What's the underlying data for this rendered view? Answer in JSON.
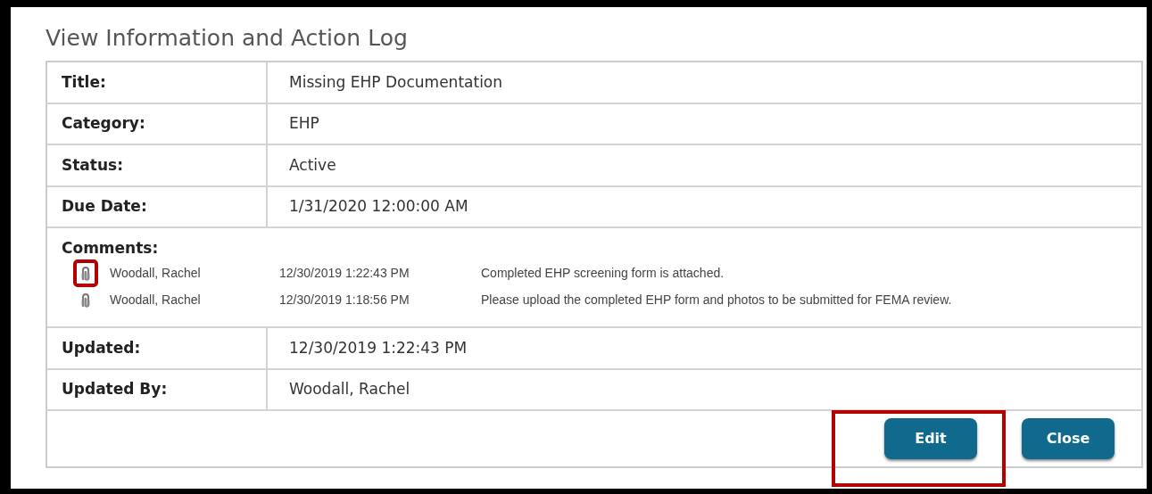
{
  "dialog": {
    "title": "View Information and Action Log"
  },
  "fields": [
    {
      "kind": "text",
      "label": "Title:",
      "value": "Missing EHP Documentation"
    },
    {
      "kind": "text",
      "label": "Category:",
      "value": "EHP"
    },
    {
      "kind": "text",
      "label": "Status:",
      "value": "Active"
    },
    {
      "kind": "text",
      "label": "Due Date:",
      "value": "1/31/2020 12:00:00 AM"
    },
    {
      "kind": "comments",
      "label": "Comments:",
      "comments": [
        {
          "author": "Woodall, Rachel",
          "time": "12/30/2019 1:22:43 PM",
          "text": "Completed EHP screening form is attached.",
          "attachment": true,
          "highlighted": true
        },
        {
          "author": "Woodall, Rachel",
          "time": "12/30/2019 1:18:56 PM",
          "text": "Please upload the completed EHP form and photos to be submitted for FEMA review.",
          "attachment": true
        }
      ]
    },
    {
      "kind": "text",
      "label": "Updated:",
      "value": "12/30/2019 1:22:43 PM"
    },
    {
      "kind": "text",
      "label": "Updated By:",
      "value": "Woodall, Rachel"
    }
  ],
  "buttons": [
    {
      "label": "Edit",
      "highlighted": true
    },
    {
      "label": "Close"
    }
  ]
}
